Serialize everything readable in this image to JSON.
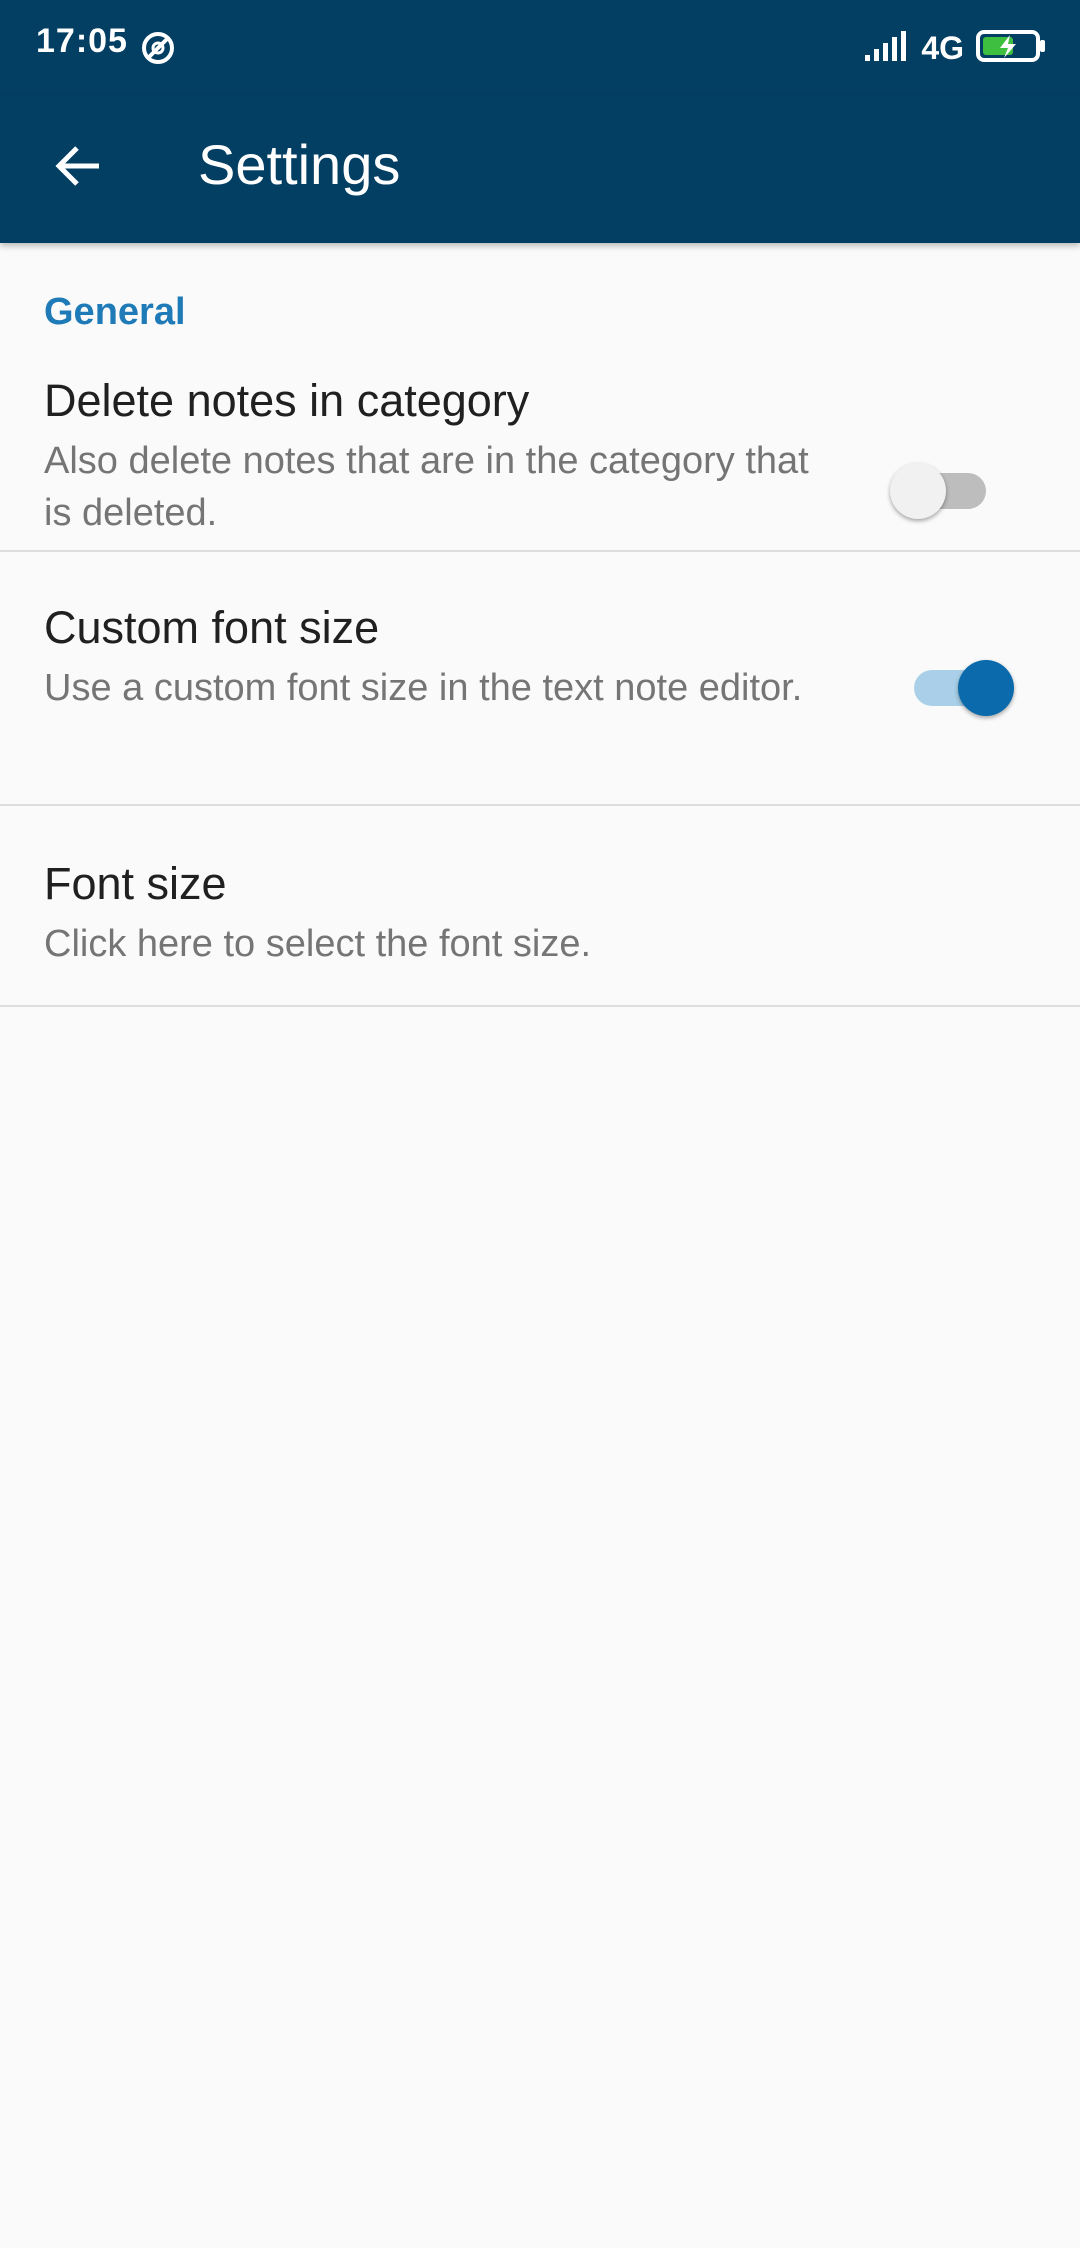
{
  "status_bar": {
    "time": "17:05",
    "app_icon": "alarm-off-icon",
    "network": "4G",
    "signal_icon": "signal-icon",
    "battery_icon": "battery-charging-icon"
  },
  "app_bar": {
    "back_icon": "arrow-back-icon",
    "title": "Settings",
    "background": "#033e63"
  },
  "section": {
    "header": "General",
    "header_color": "#1f7ab8"
  },
  "preferences": [
    {
      "title": "Delete notes in category",
      "summary": "Also delete notes that are in the category that is deleted.",
      "switch": "off"
    },
    {
      "title": "Custom font size",
      "summary": "Use a custom font size in the text note editor.",
      "switch": "on"
    },
    {
      "title": "Font size",
      "summary": "Click here to select the font size."
    }
  ],
  "colors": {
    "accent": "#0a6aab",
    "background": "#fafafa"
  }
}
